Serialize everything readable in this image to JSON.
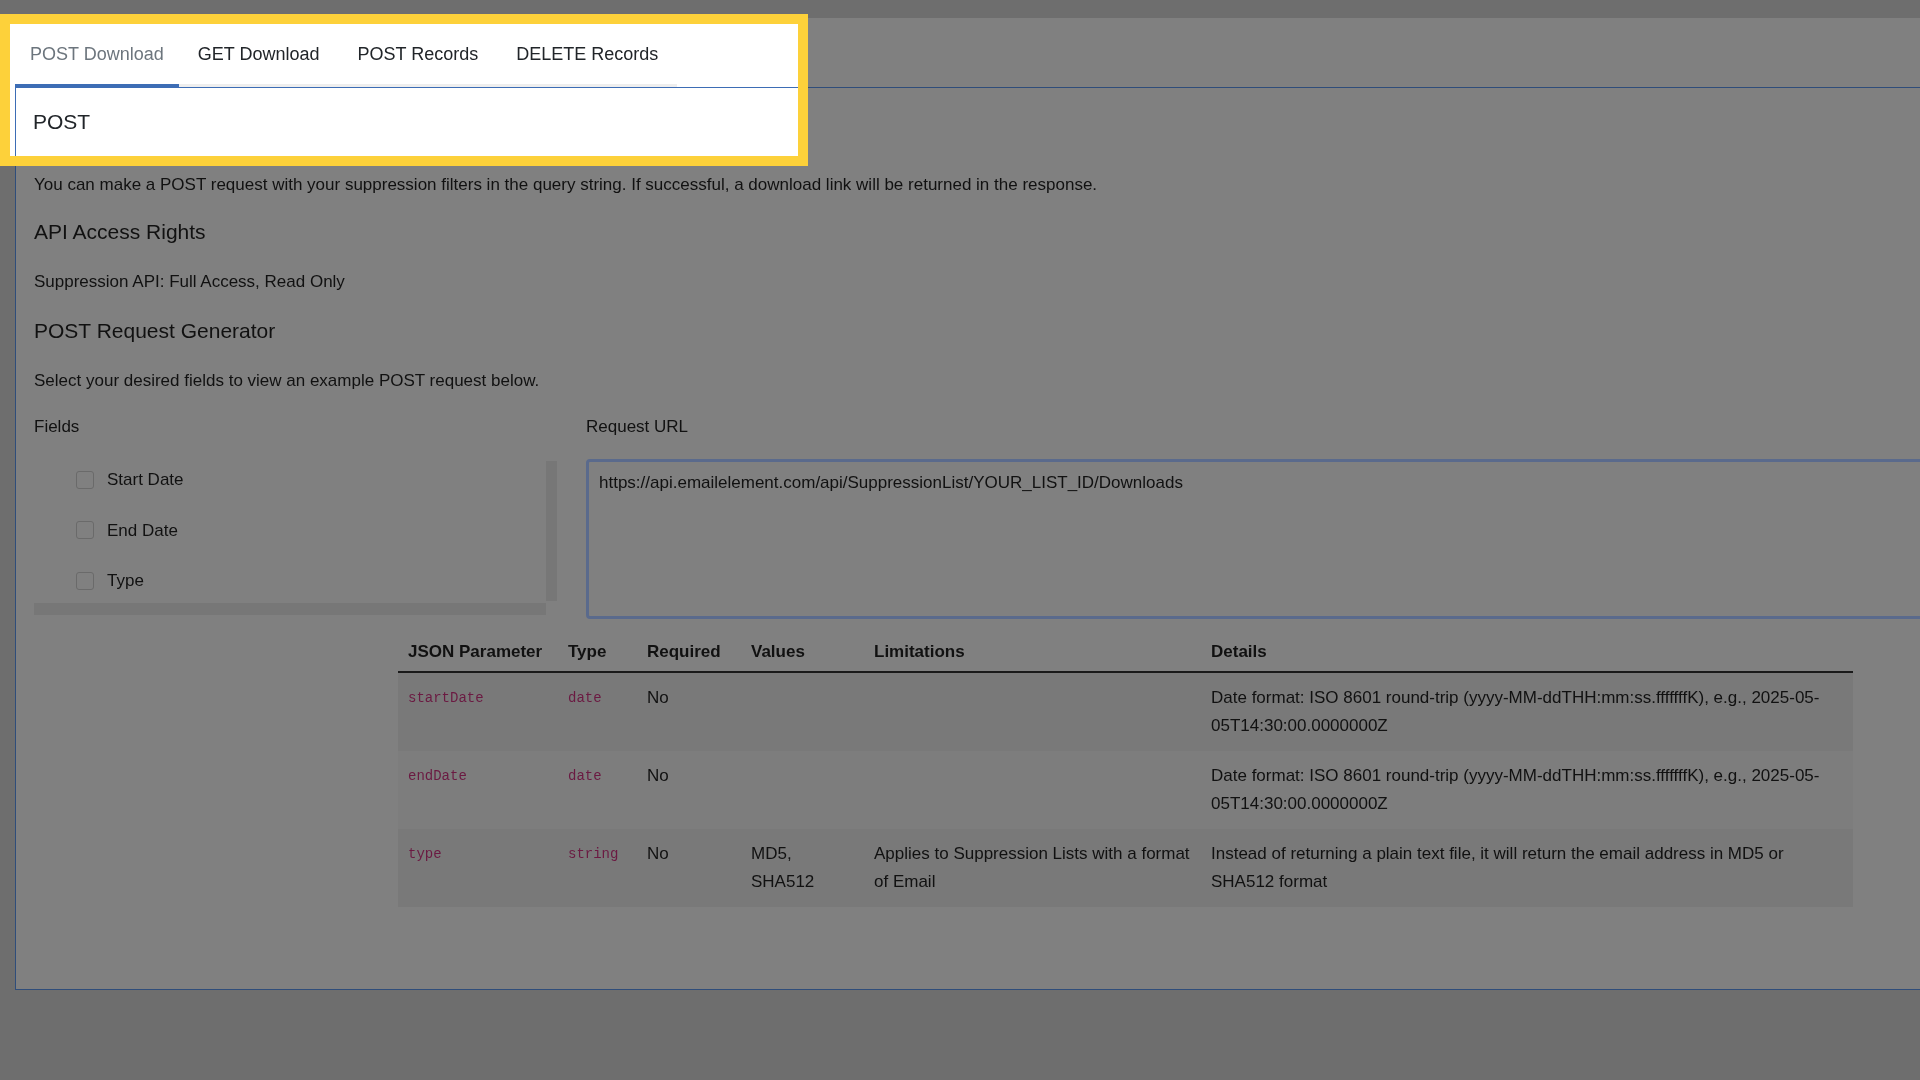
{
  "tabs": [
    {
      "label": "POST Download",
      "selected": true
    },
    {
      "label": "GET Download",
      "selected": false
    },
    {
      "label": "POST Records",
      "selected": false
    },
    {
      "label": "DELETE Records",
      "selected": false
    }
  ],
  "section_title": "POST",
  "description": "You can make a POST request with your suppression filters in the query string. If successful, a download link will be returned in the response.",
  "access": {
    "heading": "API Access Rights",
    "text": "Suppression API: Full Access, Read Only"
  },
  "generator": {
    "heading": "POST Request Generator",
    "text": "Select your desired fields to view an example POST request below.",
    "fields_label": "Fields",
    "fields": [
      {
        "label": "Start Date",
        "checked": false
      },
      {
        "label": "End Date",
        "checked": false
      },
      {
        "label": "Type",
        "checked": false
      }
    ],
    "request_url_label": "Request URL",
    "request_url": "https://api.emailelement.com/api/SuppressionList/YOUR_LIST_ID/Downloads"
  },
  "table": {
    "columns": [
      "JSON Parameter",
      "Type",
      "Required",
      "Values",
      "Limitations",
      "Details"
    ],
    "rows": [
      {
        "parameter": "startDate",
        "type": "date",
        "required": "No",
        "values": "",
        "limitations": "",
        "details": "Date format: ISO 8601 round-trip (yyyy-MM-ddTHH:mm:ss.fffffffK), e.g., 2025-05-05T14:30:00.0000000Z"
      },
      {
        "parameter": "endDate",
        "type": "date",
        "required": "No",
        "values": "",
        "limitations": "",
        "details": "Date format: ISO 8601 round-trip (yyyy-MM-ddTHH:mm:ss.fffffffK), e.g., 2025-05-05T14:30:00.0000000Z"
      },
      {
        "parameter": "type",
        "type": "string",
        "required": "No",
        "values": "MD5, SHA512",
        "limitations": "Applies to Suppression Lists with a format of Email",
        "details": "Instead of returning a plain text file, it will return the email address in MD5 or SHA512 format"
      }
    ]
  }
}
